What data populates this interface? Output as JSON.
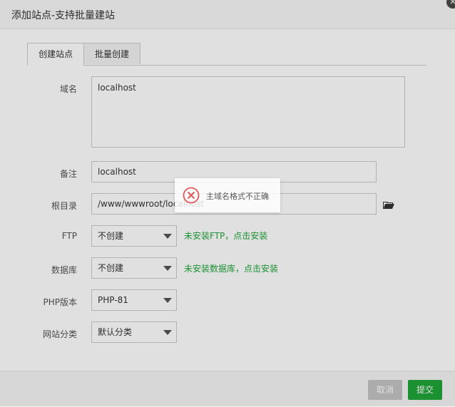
{
  "dialog": {
    "title": "添加站点-支持批量建站",
    "close_icon": "close-icon"
  },
  "tabs": [
    {
      "label": "创建站点",
      "active": true
    },
    {
      "label": "批量创建",
      "active": false
    }
  ],
  "form": {
    "domain": {
      "label": "域名",
      "value": "localhost"
    },
    "remark": {
      "label": "备注",
      "value": "localhost"
    },
    "root_dir": {
      "label": "根目录",
      "value": "/www/wwwroot/localhost",
      "icon": "folder-open-icon"
    },
    "ftp": {
      "label": "FTP",
      "value": "不创建",
      "hint": "未安装FTP，点击安装"
    },
    "database": {
      "label": "数据库",
      "value": "不创建",
      "hint": "未安装数据库，点击安装"
    },
    "php": {
      "label": "PHP版本",
      "value": "PHP-81"
    },
    "category": {
      "label": "网站分类",
      "value": "默认分类"
    }
  },
  "footer": {
    "cancel_label": "取消",
    "submit_label": "提交"
  },
  "toast": {
    "message": "主域名格式不正确",
    "icon": "error-circle-icon"
  },
  "colors": {
    "accent": "#20a53a",
    "error": "#e05a5a"
  }
}
